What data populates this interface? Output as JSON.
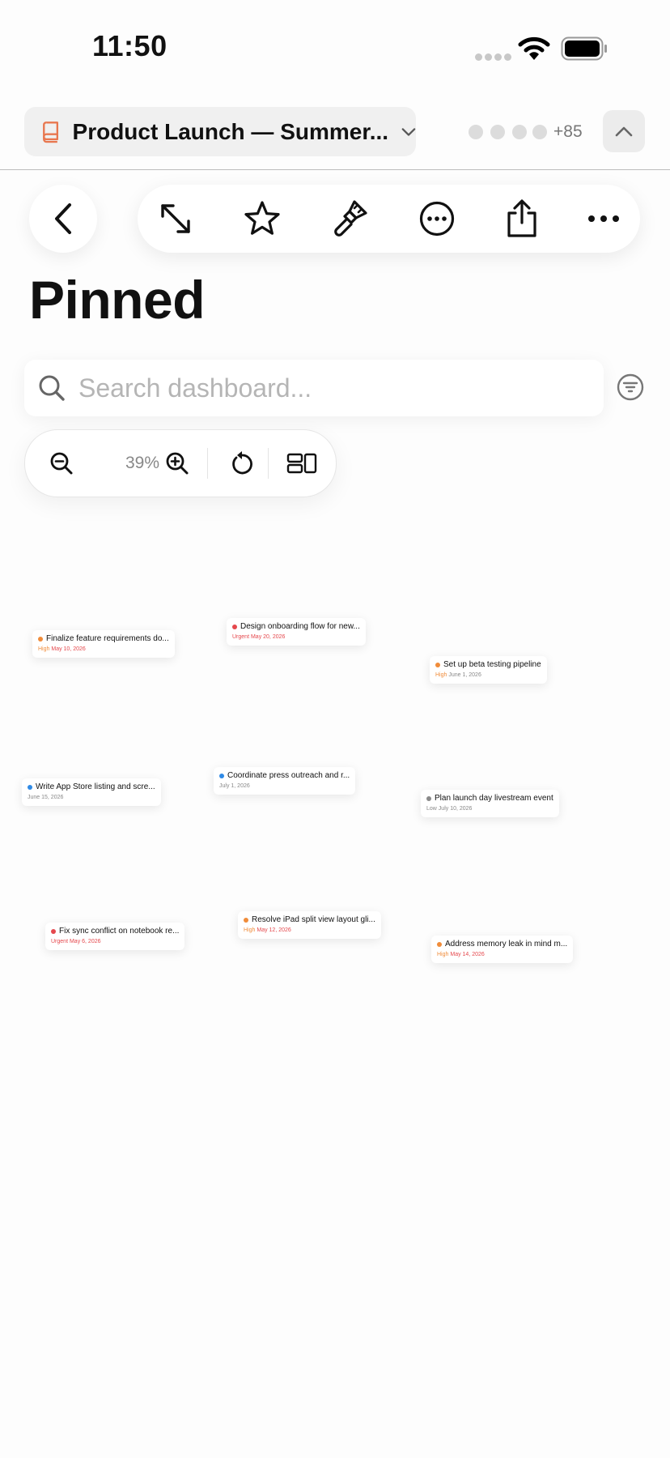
{
  "status_bar": {
    "time": "11:50"
  },
  "header": {
    "notebook_title": "Product Launch — Summer...",
    "collaborator_count": "+85"
  },
  "page_title": "Pinned",
  "search": {
    "placeholder": "Search dashboard..."
  },
  "zoom": {
    "level": "39%"
  },
  "colors": {
    "urgent": "#e5484d",
    "high": "#f08c3a",
    "medium": "#2f8ae6",
    "low": "#8a8a8a",
    "notebook_icon": "#e8774f"
  },
  "tasks": [
    {
      "title": "Finalize feature requirements do...",
      "priority": "High",
      "due": "May 10, 2026",
      "priority_color": "#f08c3a",
      "due_color": "#e5484d"
    },
    {
      "title": "Design onboarding flow for new...",
      "priority": "Urgent",
      "due": "May 20, 2026",
      "priority_color": "#e5484d",
      "due_color": "#e5484d"
    },
    {
      "title": "Set up beta testing pipeline",
      "priority": "High",
      "due": "June 1, 2026",
      "priority_color": "#f08c3a",
      "due_color": "#888888"
    },
    {
      "title": "Write App Store listing and scre...",
      "priority": "",
      "due": "June 15, 2026",
      "priority_color": "#2f8ae6",
      "due_color": "#888888"
    },
    {
      "title": "Coordinate press outreach and r...",
      "priority": "",
      "due": "July 1, 2026",
      "priority_color": "#2f8ae6",
      "due_color": "#888888"
    },
    {
      "title": "Plan launch day livestream event",
      "priority": "Low",
      "due": "July 10, 2026",
      "priority_color": "#8a8a8a",
      "due_color": "#888888"
    },
    {
      "title": "Fix sync conflict on notebook re...",
      "priority": "Urgent",
      "due": "May 6, 2026",
      "priority_color": "#e5484d",
      "due_color": "#e5484d"
    },
    {
      "title": "Resolve iPad split view layout gli...",
      "priority": "High",
      "due": "May 12, 2026",
      "priority_color": "#f08c3a",
      "due_color": "#e5484d"
    },
    {
      "title": "Address memory leak in mind m...",
      "priority": "High",
      "due": "May 14, 2026",
      "priority_color": "#f08c3a",
      "due_color": "#e5484d"
    }
  ]
}
